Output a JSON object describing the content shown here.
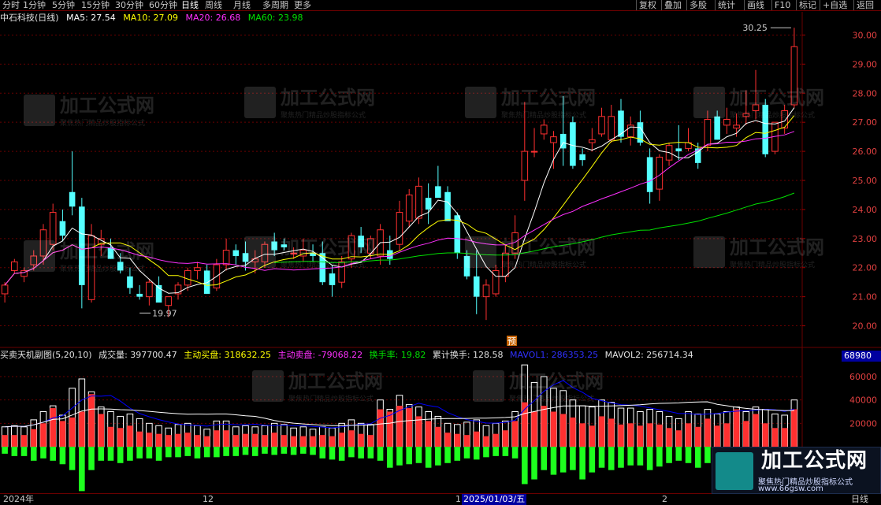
{
  "toolbar": {
    "periods": [
      "分时",
      "1分钟",
      "5分钟",
      "15分钟",
      "30分钟",
      "60分钟",
      "日线",
      "周线",
      "月线",
      "多周期",
      "更多"
    ],
    "active_period": "日线",
    "right_buttons": [
      "复权",
      "叠加",
      "多股",
      "统计",
      "画线",
      "F10",
      "标记",
      "+自选",
      "返回"
    ]
  },
  "header": {
    "stock": "中石科技(日线)",
    "ma5": "MA5: 27.54",
    "ma10": "MA10: 27.09",
    "ma20": "MA20: 26.68",
    "ma60": "MA60: 23.98"
  },
  "sub_header": {
    "name": "买卖天机副图(5,20,10)",
    "volume": "成交量: 397700.47",
    "active_buy": "主动买盘: 318632.25",
    "active_sell": "主动卖盘: -79068.22",
    "turnover": "换手率: 19.82",
    "cum_turnover": "累计换手: 128.58",
    "mavol1": "MAVOL1: 286353.25",
    "mavol2": "MAVOL2: 256714.34"
  },
  "price_labels": [
    "30.00",
    "29.00",
    "28.00",
    "27.00",
    "26.00",
    "25.00",
    "24.00",
    "23.00",
    "22.00",
    "21.00",
    "20.00"
  ],
  "vol_labels": [
    "60000",
    "40000",
    "20000"
  ],
  "vol_badge": "68980",
  "annotations": {
    "high": "30.25",
    "low": "19.97",
    "pre": "预"
  },
  "xaxis": [
    "2024年",
    "12",
    "1",
    "2025/01/03/五",
    "2",
    "日线"
  ],
  "watermark": {
    "title": "加工公式网",
    "sub": "聚焦热门精品炒股指标公式",
    "url": "www.66gsw.com"
  },
  "logo": {
    "title": "加工公式网",
    "tagline": "聚焦热门精品炒股指标公式",
    "url": "www.66gsw.com"
  },
  "colors": {
    "up": "#ff3030",
    "down": "#54ffff",
    "ma5": "#ffffff",
    "ma10": "#ffff00",
    "ma20": "#ff30ff",
    "ma60": "#00e000",
    "mavol1": "#0000ff",
    "grid": "#6a0000"
  },
  "chart_data": {
    "type": "candlestick",
    "price_range": [
      19.5,
      30.5
    ],
    "candles": [
      {
        "o": 21.1,
        "h": 21.5,
        "l": 20.8,
        "c": 21.4
      },
      {
        "o": 21.9,
        "h": 22.3,
        "l": 21.8,
        "c": 22.2
      },
      {
        "o": 21.7,
        "h": 22.0,
        "l": 21.5,
        "c": 21.9
      },
      {
        "o": 22.1,
        "h": 22.6,
        "l": 21.9,
        "c": 22.4
      },
      {
        "o": 22.4,
        "h": 23.5,
        "l": 22.1,
        "c": 23.3
      },
      {
        "o": 22.8,
        "h": 24.2,
        "l": 22.6,
        "c": 23.9
      },
      {
        "o": 23.6,
        "h": 24.0,
        "l": 22.9,
        "c": 23.1
      },
      {
        "o": 24.6,
        "h": 26.0,
        "l": 23.8,
        "c": 24.1
      },
      {
        "o": 24.1,
        "h": 24.4,
        "l": 20.6,
        "c": 21.4
      },
      {
        "o": 20.9,
        "h": 23.5,
        "l": 20.8,
        "c": 23.1
      },
      {
        "o": 22.8,
        "h": 23.3,
        "l": 22.4,
        "c": 23.0
      },
      {
        "o": 22.7,
        "h": 23.0,
        "l": 22.3,
        "c": 22.3
      },
      {
        "o": 22.2,
        "h": 22.5,
        "l": 21.8,
        "c": 21.9
      },
      {
        "o": 21.7,
        "h": 22.0,
        "l": 21.1,
        "c": 21.3
      },
      {
        "o": 21.1,
        "h": 21.4,
        "l": 20.9,
        "c": 21.0
      },
      {
        "o": 21.0,
        "h": 21.6,
        "l": 20.7,
        "c": 21.5
      },
      {
        "o": 21.4,
        "h": 21.7,
        "l": 20.9,
        "c": 20.8
      },
      {
        "o": 20.7,
        "h": 21.0,
        "l": 20.3,
        "c": 21.0
      },
      {
        "o": 21.1,
        "h": 21.5,
        "l": 20.9,
        "c": 21.4
      },
      {
        "o": 21.4,
        "h": 22.0,
        "l": 21.2,
        "c": 21.9
      },
      {
        "o": 21.9,
        "h": 22.2,
        "l": 21.6,
        "c": 22.0
      },
      {
        "o": 21.9,
        "h": 22.1,
        "l": 21.1,
        "c": 21.1
      },
      {
        "o": 21.3,
        "h": 22.3,
        "l": 21.2,
        "c": 22.1
      },
      {
        "o": 22.1,
        "h": 23.0,
        "l": 21.9,
        "c": 22.6
      },
      {
        "o": 22.6,
        "h": 22.8,
        "l": 22.1,
        "c": 22.4
      },
      {
        "o": 22.5,
        "h": 22.9,
        "l": 21.9,
        "c": 22.2
      },
      {
        "o": 22.2,
        "h": 22.6,
        "l": 21.8,
        "c": 22.3
      },
      {
        "o": 22.2,
        "h": 22.9,
        "l": 22.0,
        "c": 22.8
      },
      {
        "o": 22.9,
        "h": 23.2,
        "l": 22.4,
        "c": 22.6
      },
      {
        "o": 22.8,
        "h": 23.0,
        "l": 22.6,
        "c": 22.7
      },
      {
        "o": 22.5,
        "h": 22.7,
        "l": 22.3,
        "c": 22.5
      },
      {
        "o": 22.4,
        "h": 23.0,
        "l": 22.2,
        "c": 22.6
      },
      {
        "o": 22.5,
        "h": 22.8,
        "l": 22.2,
        "c": 22.4
      },
      {
        "o": 22.5,
        "h": 22.9,
        "l": 21.4,
        "c": 21.5
      },
      {
        "o": 21.8,
        "h": 22.1,
        "l": 21.0,
        "c": 21.4
      },
      {
        "o": 21.5,
        "h": 22.4,
        "l": 21.3,
        "c": 22.2
      },
      {
        "o": 22.3,
        "h": 23.2,
        "l": 22.0,
        "c": 23.1
      },
      {
        "o": 23.1,
        "h": 23.4,
        "l": 22.5,
        "c": 22.7
      },
      {
        "o": 22.5,
        "h": 23.1,
        "l": 22.3,
        "c": 23.0
      },
      {
        "o": 22.4,
        "h": 23.5,
        "l": 22.1,
        "c": 23.3
      },
      {
        "o": 22.6,
        "h": 23.1,
        "l": 22.1,
        "c": 22.3
      },
      {
        "o": 22.8,
        "h": 24.3,
        "l": 22.6,
        "c": 23.9
      },
      {
        "o": 23.6,
        "h": 24.7,
        "l": 23.4,
        "c": 24.5
      },
      {
        "o": 23.7,
        "h": 25.1,
        "l": 23.5,
        "c": 24.8
      },
      {
        "o": 24.4,
        "h": 24.9,
        "l": 23.5,
        "c": 24.0
      },
      {
        "o": 24.8,
        "h": 25.5,
        "l": 24.5,
        "c": 24.4
      },
      {
        "o": 24.6,
        "h": 24.8,
        "l": 23.7,
        "c": 23.6
      },
      {
        "o": 23.8,
        "h": 23.9,
        "l": 22.3,
        "c": 22.5
      },
      {
        "o": 22.4,
        "h": 22.6,
        "l": 21.6,
        "c": 21.7
      },
      {
        "o": 21.7,
        "h": 22.6,
        "l": 20.4,
        "c": 21.0
      },
      {
        "o": 21.0,
        "h": 21.6,
        "l": 20.2,
        "c": 21.4
      },
      {
        "o": 21.1,
        "h": 22.1,
        "l": 21.0,
        "c": 21.9
      },
      {
        "o": 21.7,
        "h": 22.8,
        "l": 21.5,
        "c": 22.5
      },
      {
        "o": 22.5,
        "h": 23.8,
        "l": 22.3,
        "c": 23.2
      },
      {
        "o": 25.0,
        "h": 27.7,
        "l": 24.3,
        "c": 26.0
      },
      {
        "o": 26.0,
        "h": 26.8,
        "l": 25.8,
        "c": 26.0
      },
      {
        "o": 26.6,
        "h": 27.1,
        "l": 26.4,
        "c": 26.9
      },
      {
        "o": 26.3,
        "h": 26.7,
        "l": 25.4,
        "c": 26.5
      },
      {
        "o": 26.6,
        "h": 27.9,
        "l": 25.5,
        "c": 26.1
      },
      {
        "o": 27.0,
        "h": 27.2,
        "l": 25.4,
        "c": 25.5
      },
      {
        "o": 25.9,
        "h": 26.1,
        "l": 25.5,
        "c": 25.7
      },
      {
        "o": 26.3,
        "h": 26.8,
        "l": 26.0,
        "c": 26.4
      },
      {
        "o": 26.6,
        "h": 27.5,
        "l": 26.5,
        "c": 27.2
      },
      {
        "o": 26.4,
        "h": 27.6,
        "l": 26.3,
        "c": 27.2
      },
      {
        "o": 27.4,
        "h": 27.8,
        "l": 26.3,
        "c": 26.5
      },
      {
        "o": 26.5,
        "h": 27.2,
        "l": 26.2,
        "c": 26.9
      },
      {
        "o": 27.0,
        "h": 27.4,
        "l": 26.2,
        "c": 26.3
      },
      {
        "o": 25.8,
        "h": 26.1,
        "l": 24.2,
        "c": 24.6
      },
      {
        "o": 24.7,
        "h": 25.9,
        "l": 24.3,
        "c": 25.8
      },
      {
        "o": 25.7,
        "h": 26.3,
        "l": 25.5,
        "c": 26.2
      },
      {
        "o": 26.1,
        "h": 26.9,
        "l": 25.7,
        "c": 26.0
      },
      {
        "o": 26.1,
        "h": 26.8,
        "l": 26.0,
        "c": 26.3
      },
      {
        "o": 26.1,
        "h": 26.3,
        "l": 25.4,
        "c": 25.6
      },
      {
        "o": 26.2,
        "h": 27.4,
        "l": 26.0,
        "c": 27.1
      },
      {
        "o": 27.2,
        "h": 27.4,
        "l": 26.4,
        "c": 26.4
      },
      {
        "o": 26.9,
        "h": 27.5,
        "l": 26.6,
        "c": 27.1
      },
      {
        "o": 26.8,
        "h": 27.3,
        "l": 26.5,
        "c": 26.9
      },
      {
        "o": 27.2,
        "h": 28.1,
        "l": 26.9,
        "c": 27.3
      },
      {
        "o": 27.4,
        "h": 28.8,
        "l": 27.1,
        "c": 27.6
      },
      {
        "o": 27.6,
        "h": 27.8,
        "l": 25.8,
        "c": 25.9
      },
      {
        "o": 26.0,
        "h": 27.0,
        "l": 25.9,
        "c": 27.0
      },
      {
        "o": 26.8,
        "h": 27.6,
        "l": 26.6,
        "c": 27.4
      },
      {
        "o": 27.6,
        "h": 30.25,
        "l": 27.5,
        "c": 29.6
      }
    ],
    "volume": [
      {
        "t": 17000,
        "b": 10000,
        "s": -6000
      },
      {
        "t": 18000,
        "b": 10000,
        "s": -8000
      },
      {
        "t": 17000,
        "b": 10000,
        "s": -8000
      },
      {
        "t": 23000,
        "b": 15000,
        "s": -12000
      },
      {
        "t": 30000,
        "b": 20000,
        "s": -10000
      },
      {
        "t": 35000,
        "b": 33000,
        "s": -12000
      },
      {
        "t": 27000,
        "b": 22000,
        "s": -15000
      },
      {
        "t": 50000,
        "b": 25000,
        "s": -20000
      },
      {
        "t": 58000,
        "b": 30000,
        "s": -38000
      },
      {
        "t": 47000,
        "b": 45000,
        "s": -20000
      },
      {
        "t": 34000,
        "b": 28000,
        "s": -12000
      },
      {
        "t": 30000,
        "b": 17000,
        "s": -12000
      },
      {
        "t": 26000,
        "b": 16000,
        "s": -14000
      },
      {
        "t": 28000,
        "b": 18000,
        "s": -12000
      },
      {
        "t": 24000,
        "b": 13000,
        "s": -10000
      },
      {
        "t": 20000,
        "b": 12000,
        "s": -10000
      },
      {
        "t": 18000,
        "b": 11000,
        "s": -12000
      },
      {
        "t": 16000,
        "b": 10000,
        "s": -9000
      },
      {
        "t": 19000,
        "b": 11000,
        "s": -9000
      },
      {
        "t": 20000,
        "b": 12000,
        "s": -8000
      },
      {
        "t": 18000,
        "b": 10000,
        "s": -10000
      },
      {
        "t": 15000,
        "b": 9000,
        "s": -9000
      },
      {
        "t": 22000,
        "b": 14000,
        "s": -9000
      },
      {
        "t": 22000,
        "b": 14000,
        "s": -8000
      },
      {
        "t": 17000,
        "b": 10000,
        "s": -8000
      },
      {
        "t": 18000,
        "b": 11000,
        "s": -7000
      },
      {
        "t": 17000,
        "b": 11000,
        "s": -8000
      },
      {
        "t": 18000,
        "b": 10000,
        "s": -6000
      },
      {
        "t": 20000,
        "b": 12000,
        "s": -7000
      },
      {
        "t": 19000,
        "b": 10000,
        "s": -6000
      },
      {
        "t": 16000,
        "b": 9000,
        "s": -7000
      },
      {
        "t": 17000,
        "b": 9000,
        "s": -6000
      },
      {
        "t": 15000,
        "b": 9000,
        "s": -7000
      },
      {
        "t": 17000,
        "b": 10000,
        "s": -10000
      },
      {
        "t": 16000,
        "b": 9000,
        "s": -11000
      },
      {
        "t": 20000,
        "b": 12000,
        "s": -12000
      },
      {
        "t": 23000,
        "b": 14000,
        "s": -9000
      },
      {
        "t": 20000,
        "b": 11000,
        "s": -10000
      },
      {
        "t": 19000,
        "b": 10000,
        "s": -10000
      },
      {
        "t": 40000,
        "b": 32000,
        "s": -12000
      },
      {
        "t": 32000,
        "b": 30000,
        "s": -18000
      },
      {
        "t": 44000,
        "b": 35000,
        "s": -16000
      },
      {
        "t": 36000,
        "b": 33000,
        "s": -15000
      },
      {
        "t": 34000,
        "b": 26000,
        "s": -14000
      },
      {
        "t": 30000,
        "b": 22000,
        "s": -18000
      },
      {
        "t": 26000,
        "b": 17000,
        "s": -16000
      },
      {
        "t": 20000,
        "b": 12000,
        "s": -14000
      },
      {
        "t": 19000,
        "b": 11000,
        "s": -12000
      },
      {
        "t": 21000,
        "b": 10000,
        "s": -10000
      },
      {
        "t": 23000,
        "b": 13000,
        "s": -11000
      },
      {
        "t": 18000,
        "b": 9000,
        "s": -9000
      },
      {
        "t": 20000,
        "b": 11000,
        "s": -8000
      },
      {
        "t": 22000,
        "b": 14000,
        "s": -8000
      },
      {
        "t": 30000,
        "b": 22000,
        "s": -10000
      },
      {
        "t": 70000,
        "b": 38000,
        "s": -32000
      },
      {
        "t": 55000,
        "b": 30000,
        "s": -28000
      },
      {
        "t": 60000,
        "b": 35000,
        "s": -20000
      },
      {
        "t": 50000,
        "b": 30000,
        "s": -24000
      },
      {
        "t": 48000,
        "b": 28000,
        "s": -22000
      },
      {
        "t": 40000,
        "b": 25000,
        "s": -20000
      },
      {
        "t": 35000,
        "b": 20000,
        "s": -28000
      },
      {
        "t": 34000,
        "b": 18000,
        "s": -22000
      },
      {
        "t": 40000,
        "b": 26000,
        "s": -18000
      },
      {
        "t": 38000,
        "b": 24000,
        "s": -20000
      },
      {
        "t": 33000,
        "b": 19000,
        "s": -18000
      },
      {
        "t": 33000,
        "b": 20000,
        "s": -16000
      },
      {
        "t": 30000,
        "b": 18000,
        "s": -16000
      },
      {
        "t": 32000,
        "b": 20000,
        "s": -20000
      },
      {
        "t": 30000,
        "b": 19000,
        "s": -17000
      },
      {
        "t": 26000,
        "b": 16000,
        "s": -14000
      },
      {
        "t": 24000,
        "b": 14000,
        "s": -12000
      },
      {
        "t": 30000,
        "b": 20000,
        "s": -14000
      },
      {
        "t": 28000,
        "b": 17000,
        "s": -18000
      },
      {
        "t": 32000,
        "b": 24000,
        "s": -14000
      },
      {
        "t": 28000,
        "b": 18000,
        "s": -15000
      },
      {
        "t": 30000,
        "b": 20000,
        "s": -16000
      },
      {
        "t": 34000,
        "b": 32000,
        "s": -18000
      },
      {
        "t": 30000,
        "b": 22000,
        "s": -16000
      },
      {
        "t": 34000,
        "b": 28000,
        "s": -14000
      },
      {
        "t": 32000,
        "b": 20000,
        "s": -26000
      },
      {
        "t": 28000,
        "b": 16000,
        "s": -22000
      },
      {
        "t": 27000,
        "b": 16000,
        "s": -16000
      },
      {
        "t": 40000,
        "b": 32000,
        "s": -8000
      }
    ]
  }
}
